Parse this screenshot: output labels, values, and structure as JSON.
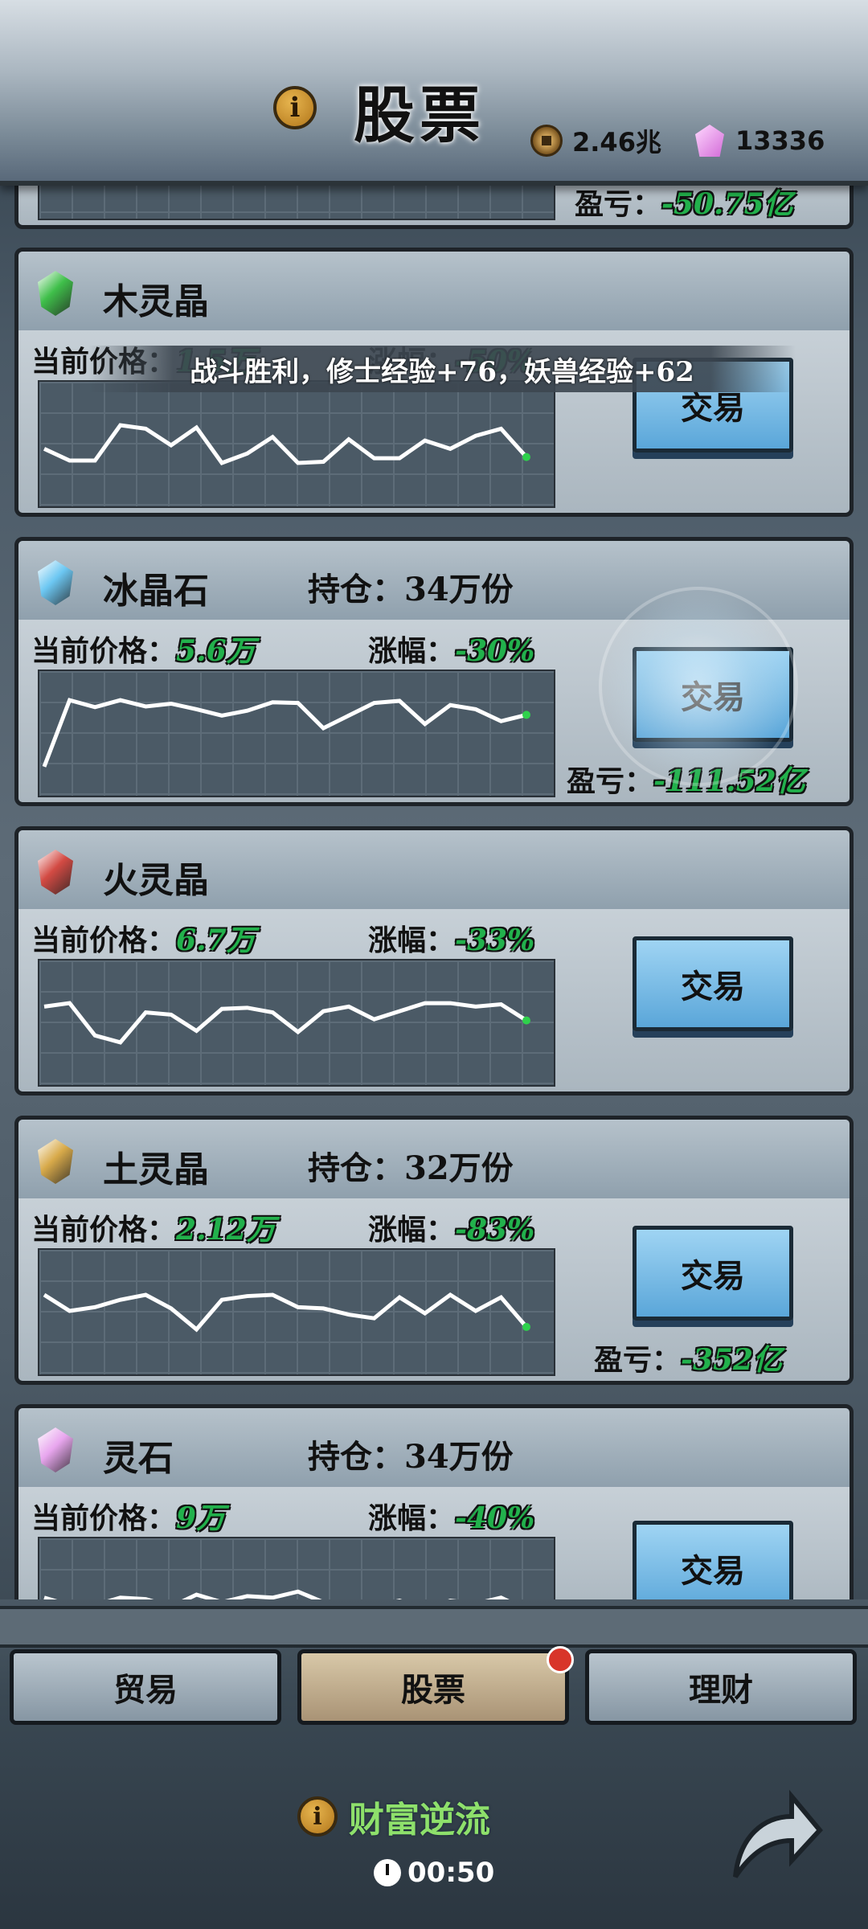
{
  "header": {
    "title": "股票",
    "info_icon": "info-icon",
    "coins": "2.46兆",
    "gems": "13336"
  },
  "toast": "战斗胜利，修士经验+76，妖兽经验+62",
  "top_partial": {
    "pnl_label": "盈亏：",
    "pnl_value": "-50.75亿"
  },
  "labels": {
    "price": "当前价格：",
    "change": "涨幅：",
    "pnl": "盈亏：",
    "trade": "交易"
  },
  "stocks": [
    {
      "name": "木灵晶",
      "holding": "",
      "price": "1.5万",
      "change": "-50%",
      "pnl": "",
      "color": "#3fbf4a",
      "chart": [
        280,
        270,
        270,
        300,
        297,
        283,
        298,
        268,
        276,
        290,
        268,
        269,
        288,
        272,
        272,
        287,
        280,
        291,
        297,
        273
      ]
    },
    {
      "name": "冰晶石",
      "holding": "持仓：34万份",
      "price": "5.6万",
      "change": "-30%",
      "pnl": "-111.52亿",
      "color": "#6cc7f2",
      "chart": [
        270,
        365,
        355,
        365,
        356,
        360,
        352,
        343,
        350,
        362,
        361,
        325,
        343,
        361,
        364,
        331,
        358,
        352,
        335,
        344
      ]
    },
    {
      "name": "火灵晶",
      "holding": "",
      "price": "6.7万",
      "change": "-33%",
      "pnl": "",
      "color": "#d34a43",
      "chart": [
        312,
        315,
        287,
        281,
        307,
        305,
        291,
        310,
        311,
        307,
        290,
        308,
        312,
        301,
        308,
        315,
        315,
        312,
        314,
        300
      ]
    },
    {
      "name": "土灵晶",
      "holding": "持仓：32万份",
      "price": "2.12万",
      "change": "-83%",
      "pnl": "-352亿",
      "color": "#d8aa4a",
      "chart": [
        387,
        374,
        377,
        383,
        387,
        376,
        359,
        383,
        386,
        387,
        377,
        376,
        371,
        368,
        385,
        372,
        387,
        374,
        385,
        361
      ]
    },
    {
      "name": "灵石",
      "holding": "持仓：34万份",
      "price": "9万",
      "change": "-40%",
      "pnl": "",
      "color": "#e8a6ee",
      "chart": [
        243,
        238,
        238,
        243,
        242,
        237,
        245,
        240,
        244,
        243,
        247,
        240,
        238,
        237,
        241,
        235,
        241,
        239,
        243,
        235
      ]
    }
  ],
  "tabs": [
    "贸易",
    "股票",
    "理财"
  ],
  "footer": {
    "event": "财富逆流",
    "timer": "00:50"
  }
}
